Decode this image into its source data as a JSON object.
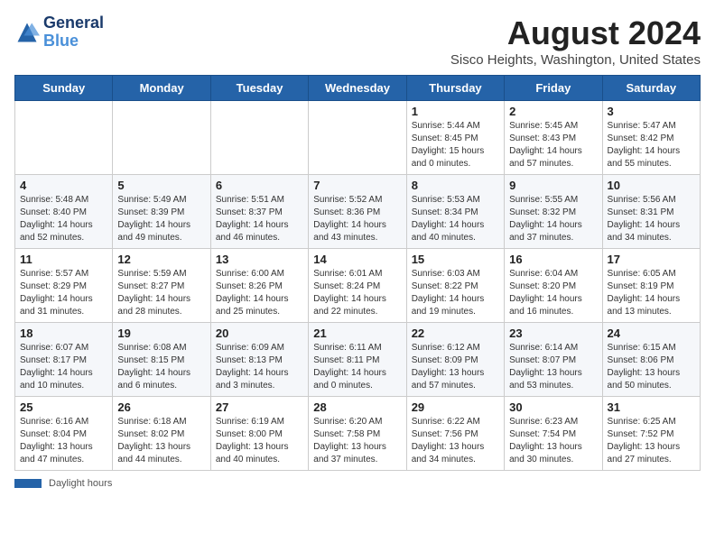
{
  "header": {
    "logo_general": "General",
    "logo_blue": "Blue",
    "month_title": "August 2024",
    "location": "Sisco Heights, Washington, United States"
  },
  "calendar": {
    "days_of_week": [
      "Sunday",
      "Monday",
      "Tuesday",
      "Wednesday",
      "Thursday",
      "Friday",
      "Saturday"
    ],
    "weeks": [
      [
        {
          "day": "",
          "sunrise": "",
          "sunset": "",
          "daylight": ""
        },
        {
          "day": "",
          "sunrise": "",
          "sunset": "",
          "daylight": ""
        },
        {
          "day": "",
          "sunrise": "",
          "sunset": "",
          "daylight": ""
        },
        {
          "day": "",
          "sunrise": "",
          "sunset": "",
          "daylight": ""
        },
        {
          "day": "1",
          "sunrise": "Sunrise: 5:44 AM",
          "sunset": "Sunset: 8:45 PM",
          "daylight": "Daylight: 15 hours and 0 minutes."
        },
        {
          "day": "2",
          "sunrise": "Sunrise: 5:45 AM",
          "sunset": "Sunset: 8:43 PM",
          "daylight": "Daylight: 14 hours and 57 minutes."
        },
        {
          "day": "3",
          "sunrise": "Sunrise: 5:47 AM",
          "sunset": "Sunset: 8:42 PM",
          "daylight": "Daylight: 14 hours and 55 minutes."
        }
      ],
      [
        {
          "day": "4",
          "sunrise": "Sunrise: 5:48 AM",
          "sunset": "Sunset: 8:40 PM",
          "daylight": "Daylight: 14 hours and 52 minutes."
        },
        {
          "day": "5",
          "sunrise": "Sunrise: 5:49 AM",
          "sunset": "Sunset: 8:39 PM",
          "daylight": "Daylight: 14 hours and 49 minutes."
        },
        {
          "day": "6",
          "sunrise": "Sunrise: 5:51 AM",
          "sunset": "Sunset: 8:37 PM",
          "daylight": "Daylight: 14 hours and 46 minutes."
        },
        {
          "day": "7",
          "sunrise": "Sunrise: 5:52 AM",
          "sunset": "Sunset: 8:36 PM",
          "daylight": "Daylight: 14 hours and 43 minutes."
        },
        {
          "day": "8",
          "sunrise": "Sunrise: 5:53 AM",
          "sunset": "Sunset: 8:34 PM",
          "daylight": "Daylight: 14 hours and 40 minutes."
        },
        {
          "day": "9",
          "sunrise": "Sunrise: 5:55 AM",
          "sunset": "Sunset: 8:32 PM",
          "daylight": "Daylight: 14 hours and 37 minutes."
        },
        {
          "day": "10",
          "sunrise": "Sunrise: 5:56 AM",
          "sunset": "Sunset: 8:31 PM",
          "daylight": "Daylight: 14 hours and 34 minutes."
        }
      ],
      [
        {
          "day": "11",
          "sunrise": "Sunrise: 5:57 AM",
          "sunset": "Sunset: 8:29 PM",
          "daylight": "Daylight: 14 hours and 31 minutes."
        },
        {
          "day": "12",
          "sunrise": "Sunrise: 5:59 AM",
          "sunset": "Sunset: 8:27 PM",
          "daylight": "Daylight: 14 hours and 28 minutes."
        },
        {
          "day": "13",
          "sunrise": "Sunrise: 6:00 AM",
          "sunset": "Sunset: 8:26 PM",
          "daylight": "Daylight: 14 hours and 25 minutes."
        },
        {
          "day": "14",
          "sunrise": "Sunrise: 6:01 AM",
          "sunset": "Sunset: 8:24 PM",
          "daylight": "Daylight: 14 hours and 22 minutes."
        },
        {
          "day": "15",
          "sunrise": "Sunrise: 6:03 AM",
          "sunset": "Sunset: 8:22 PM",
          "daylight": "Daylight: 14 hours and 19 minutes."
        },
        {
          "day": "16",
          "sunrise": "Sunrise: 6:04 AM",
          "sunset": "Sunset: 8:20 PM",
          "daylight": "Daylight: 14 hours and 16 minutes."
        },
        {
          "day": "17",
          "sunrise": "Sunrise: 6:05 AM",
          "sunset": "Sunset: 8:19 PM",
          "daylight": "Daylight: 14 hours and 13 minutes."
        }
      ],
      [
        {
          "day": "18",
          "sunrise": "Sunrise: 6:07 AM",
          "sunset": "Sunset: 8:17 PM",
          "daylight": "Daylight: 14 hours and 10 minutes."
        },
        {
          "day": "19",
          "sunrise": "Sunrise: 6:08 AM",
          "sunset": "Sunset: 8:15 PM",
          "daylight": "Daylight: 14 hours and 6 minutes."
        },
        {
          "day": "20",
          "sunrise": "Sunrise: 6:09 AM",
          "sunset": "Sunset: 8:13 PM",
          "daylight": "Daylight: 14 hours and 3 minutes."
        },
        {
          "day": "21",
          "sunrise": "Sunrise: 6:11 AM",
          "sunset": "Sunset: 8:11 PM",
          "daylight": "Daylight: 14 hours and 0 minutes."
        },
        {
          "day": "22",
          "sunrise": "Sunrise: 6:12 AM",
          "sunset": "Sunset: 8:09 PM",
          "daylight": "Daylight: 13 hours and 57 minutes."
        },
        {
          "day": "23",
          "sunrise": "Sunrise: 6:14 AM",
          "sunset": "Sunset: 8:07 PM",
          "daylight": "Daylight: 13 hours and 53 minutes."
        },
        {
          "day": "24",
          "sunrise": "Sunrise: 6:15 AM",
          "sunset": "Sunset: 8:06 PM",
          "daylight": "Daylight: 13 hours and 50 minutes."
        }
      ],
      [
        {
          "day": "25",
          "sunrise": "Sunrise: 6:16 AM",
          "sunset": "Sunset: 8:04 PM",
          "daylight": "Daylight: 13 hours and 47 minutes."
        },
        {
          "day": "26",
          "sunrise": "Sunrise: 6:18 AM",
          "sunset": "Sunset: 8:02 PM",
          "daylight": "Daylight: 13 hours and 44 minutes."
        },
        {
          "day": "27",
          "sunrise": "Sunrise: 6:19 AM",
          "sunset": "Sunset: 8:00 PM",
          "daylight": "Daylight: 13 hours and 40 minutes."
        },
        {
          "day": "28",
          "sunrise": "Sunrise: 6:20 AM",
          "sunset": "Sunset: 7:58 PM",
          "daylight": "Daylight: 13 hours and 37 minutes."
        },
        {
          "day": "29",
          "sunrise": "Sunrise: 6:22 AM",
          "sunset": "Sunset: 7:56 PM",
          "daylight": "Daylight: 13 hours and 34 minutes."
        },
        {
          "day": "30",
          "sunrise": "Sunrise: 6:23 AM",
          "sunset": "Sunset: 7:54 PM",
          "daylight": "Daylight: 13 hours and 30 minutes."
        },
        {
          "day": "31",
          "sunrise": "Sunrise: 6:25 AM",
          "sunset": "Sunset: 7:52 PM",
          "daylight": "Daylight: 13 hours and 27 minutes."
        }
      ]
    ]
  },
  "footer": {
    "daylight_label": "Daylight hours"
  }
}
